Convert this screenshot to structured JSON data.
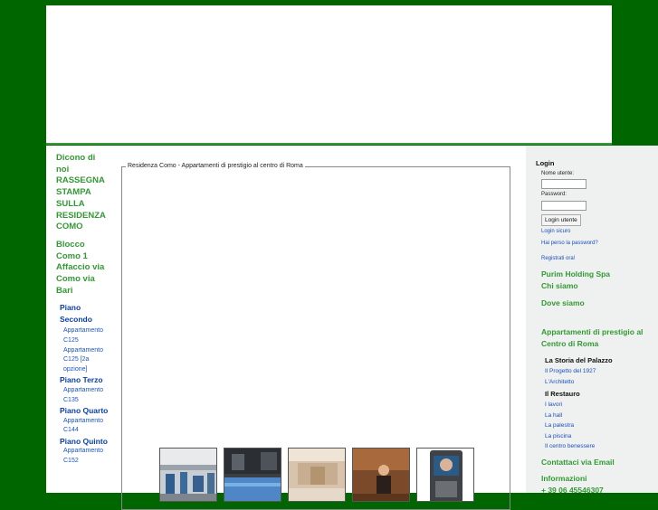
{
  "left_nav": {
    "dicono": "Dicono di noi",
    "rassegna": "RASSEGNA STAMPA SULLA RESIDENZA COMO",
    "blocco": "Blocco Como 1 Affaccio via Como via Bari",
    "floors": [
      {
        "label": "Piano Secondo",
        "apartments": [
          "Appartamento C125",
          "Appartamento C125 [2a opzione]"
        ]
      },
      {
        "label": "Piano Terzo",
        "apartments": [
          "Appartamento C135"
        ]
      },
      {
        "label": "Piano Quarto",
        "apartments": [
          "Appartamento C144"
        ]
      },
      {
        "label": "Piano Quinto",
        "apartments": [
          "Appartamento C152"
        ]
      }
    ]
  },
  "content": {
    "legend": "Residenza Como - Appartamenti di prestigio al centro di Roma"
  },
  "login": {
    "title": "Login",
    "username_label": "Nome utente:",
    "password_label": "Password:",
    "button_label": "Login utente",
    "secure_link": "Login sicuro",
    "forgot_link": "Hai perso la password?",
    "register_link": "Registrati ora!"
  },
  "right_nav": {
    "company": "Purim Holding Spa",
    "about": "Chi siamo",
    "where": "Dove siamo",
    "prestige": "Appartamenti di prestigio al Centro di Roma",
    "history_title": "La Storia del Palazzo",
    "history_items": [
      "Il Progetto del 1927",
      "L'Architetto"
    ],
    "restoration_title": "Il Restauro",
    "restoration_items": [
      "I lavori",
      "La hall",
      "La palestra",
      "La piscina",
      "Il centro benessere"
    ],
    "contact_email": "Contattaci via Email",
    "info": "Informazioni",
    "phone": "+ 39 06 45546307"
  },
  "colors": {
    "page_bg": "#006600",
    "nav_green": "#339933",
    "link_blue": "#1a4fc0"
  }
}
